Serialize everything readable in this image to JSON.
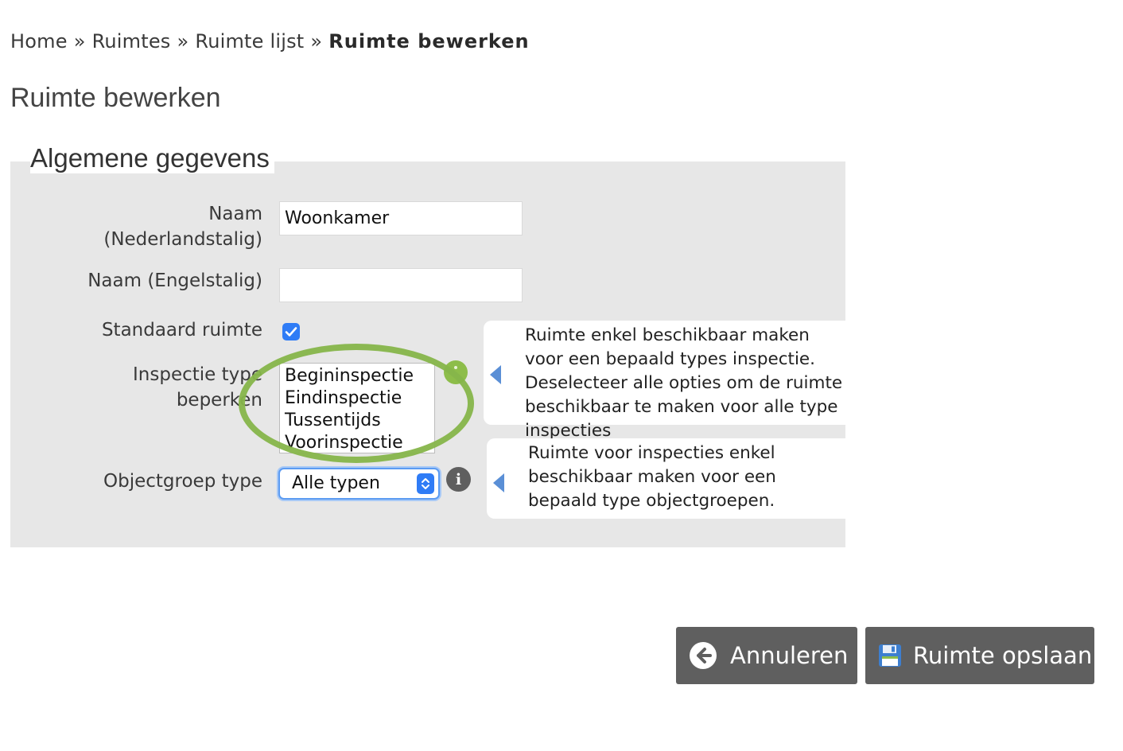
{
  "breadcrumb": {
    "items": [
      "Home",
      "Ruimtes",
      "Ruimte lijst"
    ],
    "separator": "»",
    "current": "Ruimte bewerken"
  },
  "page_title": "Ruimte bewerken",
  "section": {
    "legend": "Algemene gegevens",
    "fields": {
      "name_nl": {
        "label_line1": "Naam",
        "label_line2": "(Nederlandstalig)",
        "value": "Woonkamer",
        "placeholder": ""
      },
      "name_en": {
        "label": "Naam (Engelstalig)",
        "value": "",
        "placeholder": ""
      },
      "standard_room": {
        "label": "Standaard ruimte",
        "checked": true
      },
      "inspection_type": {
        "label_line1": "Inspectie type",
        "label_line2": "beperken",
        "options": [
          "Begininspectie",
          "Eindinspectie",
          "Tussentijds",
          "Voorinspectie"
        ],
        "help": "Ruimte enkel beschikbaar maken voor een bepaald types inspectie. Deselecteer alle opties om de ruimte beschikbaar te maken voor alle type inspecties"
      },
      "object_group_type": {
        "label": "Objectgroep type",
        "selected": "Alle typen",
        "help": "Ruimte voor inspecties enkel beschikbaar maken voor een bepaald type objectgroepen."
      }
    }
  },
  "actions": {
    "cancel_label": "Annuleren",
    "save_label": "Ruimte opslaan"
  },
  "colors": {
    "panel_bg": "#e7e7e7",
    "button_bg": "#5f5f5f",
    "accent_blue": "#2f7cf6",
    "highlight_green": "#86b54a"
  },
  "icons": {
    "checkbox": "checkmark-icon",
    "select": "select-arrows-icon",
    "info": "info-icon",
    "cancel": "arrow-left-circle-icon",
    "save": "floppy-disk-icon"
  }
}
